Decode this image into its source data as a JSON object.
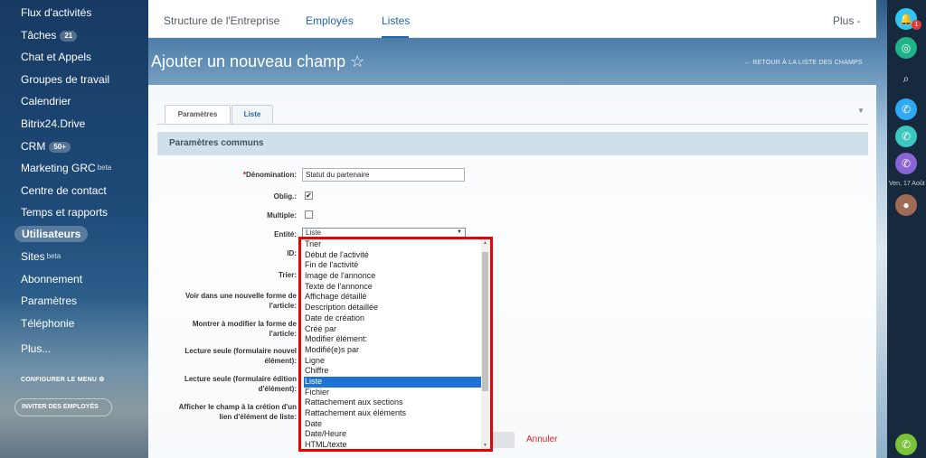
{
  "sidebar": {
    "items": [
      {
        "label": "Flux d'activités"
      },
      {
        "label": "Tâches",
        "badge": "21"
      },
      {
        "label": "Chat et Appels"
      },
      {
        "label": "Groupes de travail"
      },
      {
        "label": "Calendrier"
      },
      {
        "label": "Bitrix24.Drive"
      },
      {
        "label": "CRM",
        "badge": "50+"
      },
      {
        "label": "Marketing GRC",
        "sup": "beta"
      },
      {
        "label": "Centre de contact"
      },
      {
        "label": "Temps et rapports"
      },
      {
        "label": "Utilisateurs"
      },
      {
        "label": "Sites",
        "sup": "beta"
      },
      {
        "label": "Abonnement"
      },
      {
        "label": "Paramètres"
      },
      {
        "label": "Téléphonie"
      },
      {
        "label": "Plus..."
      }
    ],
    "configure_menu": "CONFIGURER LE MENU",
    "invite_button": "INVITER DES EMPLOYÉS"
  },
  "topnav": {
    "tabs": [
      "Structure de l'Entreprise",
      "Employés",
      "Listes"
    ],
    "more": "Plus -"
  },
  "page": {
    "title": "Ajouter un nouveau champ ☆",
    "back_link": "← RETOUR À LA LISTE DES CHAMPS"
  },
  "form": {
    "tabs": [
      "Paramètres",
      "Liste"
    ],
    "section_title": "Paramètres communs",
    "labels": {
      "name": "Dénomination:",
      "required": "Oblig.:",
      "multiple": "Multiple:",
      "entity": "Entité:",
      "id": "ID:",
      "sort": "Trier:",
      "show_new": "Voir dans une nouvelle forme de l'article:",
      "show_edit": "Montrer à modifier la forme de l'article:",
      "readonly_new": "Lecture seule (formulaire nouvel élément):",
      "readonly_edit": "Lecture seule (formulaire édition d'élément):",
      "show_link": "Afficher le champ à la crétion d'un lien d'élément de liste:"
    },
    "name_value": "Statut du partenaire",
    "required_checked": "✔",
    "entity_value": "Liste",
    "cancel": "Annuler"
  },
  "dropdown": {
    "options": [
      "Trier",
      "Début de l'activité",
      "Fin de l'activité",
      "Image de l'annonce",
      "Texte de l'annonce",
      "Affichage détaillé",
      "Description détaillée",
      "Date de création",
      "Créé par",
      "Modifier élément:",
      "Modifié(e)s par",
      "Ligne",
      "Chiffre",
      "Liste",
      "Fichier",
      "Rattachement aux sections",
      "Rattachement aux éléments",
      "Date",
      "Date/Heure",
      "HTML/texte"
    ],
    "selected": "Liste"
  },
  "rightbar": {
    "date": "Ven, 17 Août",
    "notif_count": "1"
  }
}
